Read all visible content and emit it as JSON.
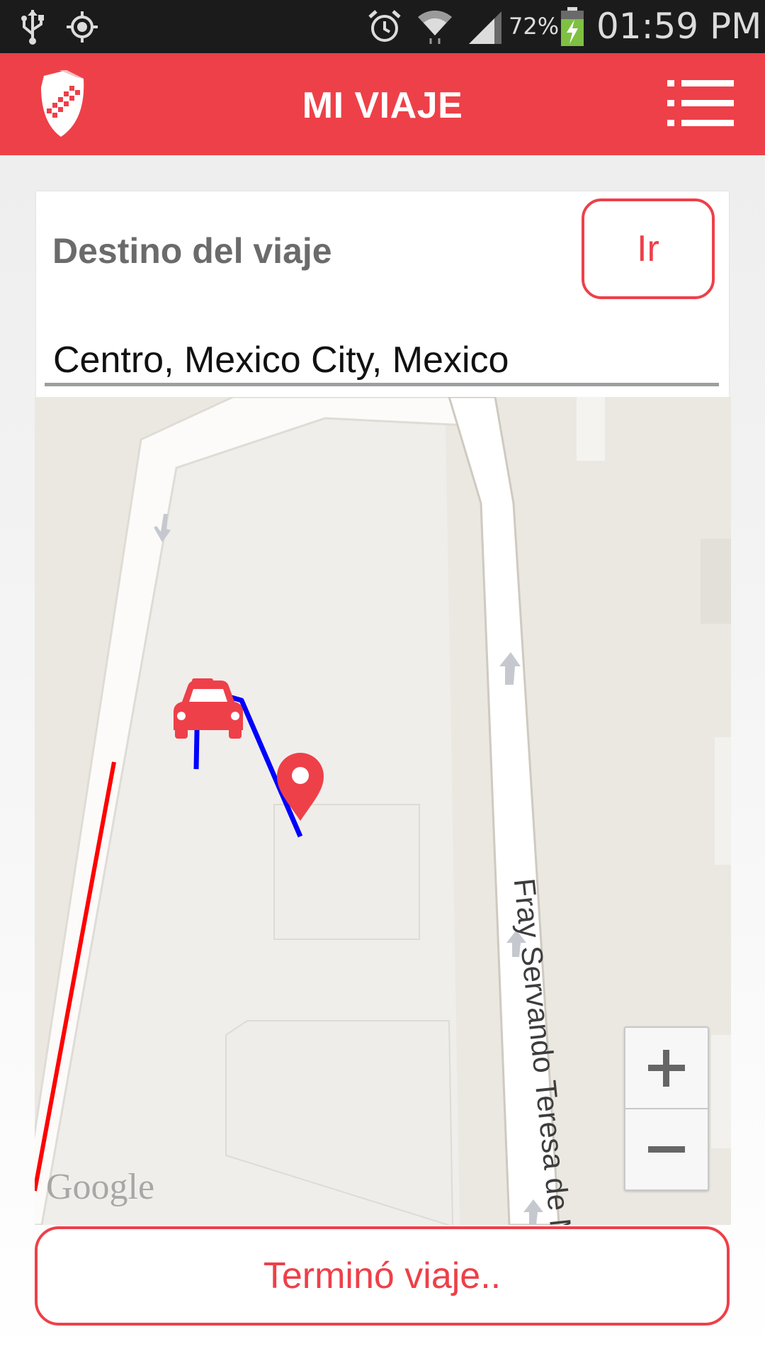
{
  "status_bar": {
    "battery_percent": "72%",
    "time": "01:59 PM",
    "icons": [
      "usb-icon",
      "gps-icon",
      "alarm-icon",
      "wifi-icon",
      "signal-icon",
      "battery-charging-icon"
    ]
  },
  "app_bar": {
    "title": "MI VIAJE",
    "logo_icon": "shield-logo-icon",
    "menu_icon": "menu-list-icon"
  },
  "destination": {
    "label": "Destino del viaje",
    "go_button": "Ir",
    "input_value": "Centro, Mexico City, Mexico"
  },
  "map": {
    "street_name": "Fray Servando Teresa de Mier",
    "attribution": "Google",
    "zoom_in": "+",
    "zoom_out": "−",
    "markers": [
      "taxi-icon",
      "destination-pin-icon"
    ],
    "colors": {
      "route": "#0000ff",
      "traveled_path": "#ff0000",
      "marker": "#ee4049"
    }
  },
  "actions": {
    "end_trip_button": "Terminó viaje.."
  },
  "theme": {
    "accent": "#ee4049",
    "status_bar_bg": "#1b1b1b"
  }
}
